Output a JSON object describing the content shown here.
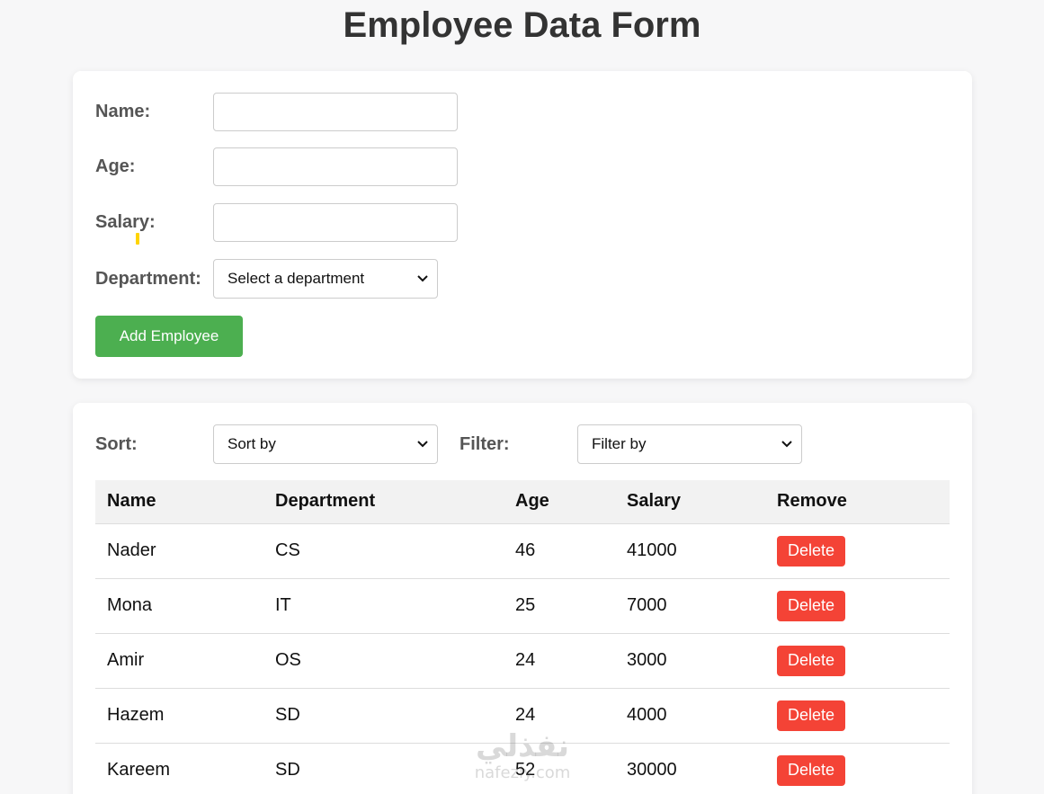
{
  "page": {
    "title": "Employee Data Form"
  },
  "form": {
    "name_label": "Name:",
    "name_value": "",
    "age_label": "Age:",
    "age_value": "",
    "salary_label": "Salary:",
    "salary_value": "",
    "department_label": "Department:",
    "department_selected": "Select a department",
    "add_button_label": "Add Employee"
  },
  "controls": {
    "sort_label": "Sort:",
    "sort_selected": "Sort by",
    "filter_label": "Filter:",
    "filter_selected": "Filter by"
  },
  "table": {
    "headers": [
      "Name",
      "Department",
      "Age",
      "Salary",
      "Remove"
    ],
    "rows": [
      {
        "name": "Nader",
        "department": "CS",
        "age": "46",
        "salary": "41000",
        "action": "Delete"
      },
      {
        "name": "Mona",
        "department": "IT",
        "age": "25",
        "salary": "7000",
        "action": "Delete"
      },
      {
        "name": "Amir",
        "department": "OS",
        "age": "24",
        "salary": "3000",
        "action": "Delete"
      },
      {
        "name": "Hazem",
        "department": "SD",
        "age": "24",
        "salary": "4000",
        "action": "Delete"
      },
      {
        "name": "Kareem",
        "department": "SD",
        "age": "52",
        "salary": "30000",
        "action": "Delete"
      }
    ]
  },
  "watermark": {
    "arabic": "نفذلي",
    "latin": "nafezly.com"
  },
  "colors": {
    "add_button": "#4caf50",
    "delete_button": "#f44336",
    "header_bg": "#f2f2f2"
  }
}
